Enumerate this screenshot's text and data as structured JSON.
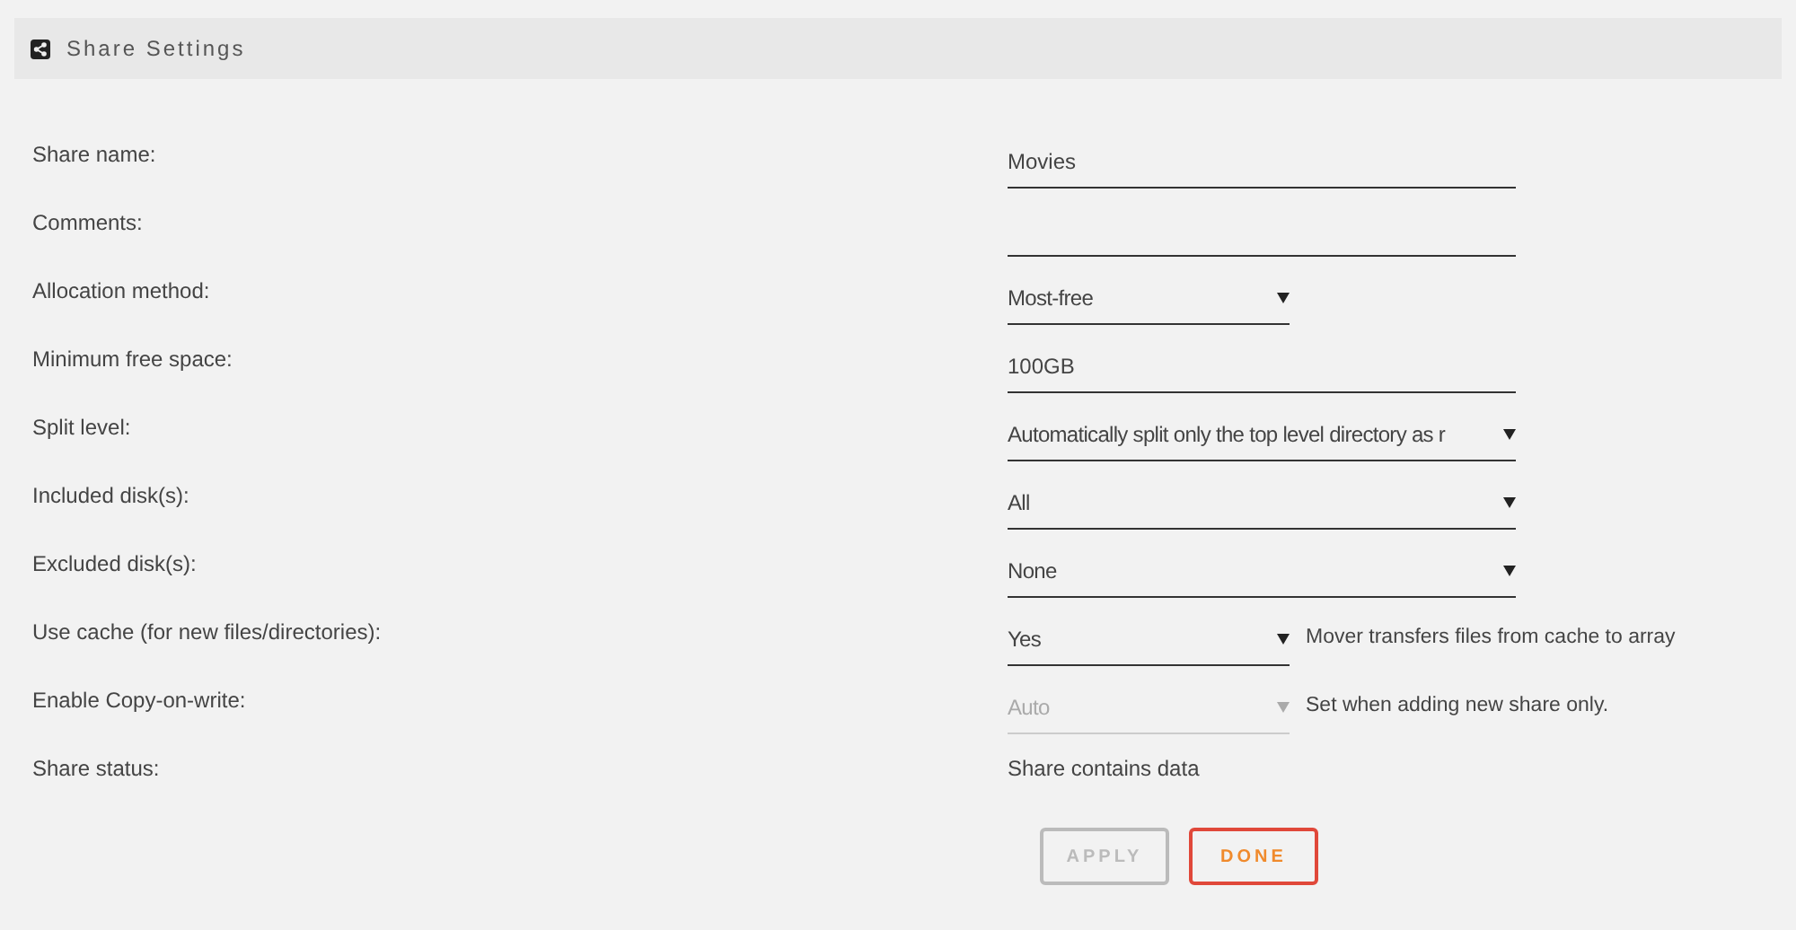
{
  "header": {
    "title": "Share Settings"
  },
  "rows": [
    {
      "label": "Share name:",
      "kind": "input",
      "value": "Movies"
    },
    {
      "label": "Comments:",
      "kind": "input"
    },
    {
      "label": "Allocation method:",
      "kind": "short-select",
      "value": "Most-free",
      "disabled": false
    },
    {
      "label": "Minimum free space:",
      "kind": "input",
      "value": "100GB"
    },
    {
      "label": "Split level:",
      "kind": "select",
      "value": "Automatically split only the top level directory as r",
      "disabled": false
    },
    {
      "label": "Included disk(s):",
      "kind": "select",
      "value": "All",
      "disabled": false
    },
    {
      "label": "Excluded disk(s):",
      "kind": "select",
      "value": "None",
      "disabled": false
    },
    {
      "label": "Use cache (for new files/directories):",
      "kind": "short-select",
      "value": "Yes",
      "disabled": false,
      "note": "Mover transfers files from cache to array"
    },
    {
      "label": "Enable Copy-on-write:",
      "kind": "short-select",
      "value": "Auto",
      "disabled": true,
      "note": "Set when adding new share only."
    },
    {
      "label": "Share status:",
      "kind": "text",
      "value": "Share contains data"
    }
  ],
  "buttons": [
    {
      "label": "APPLY",
      "disabled": true
    },
    {
      "label": "DONE",
      "disabled": false
    }
  ]
}
